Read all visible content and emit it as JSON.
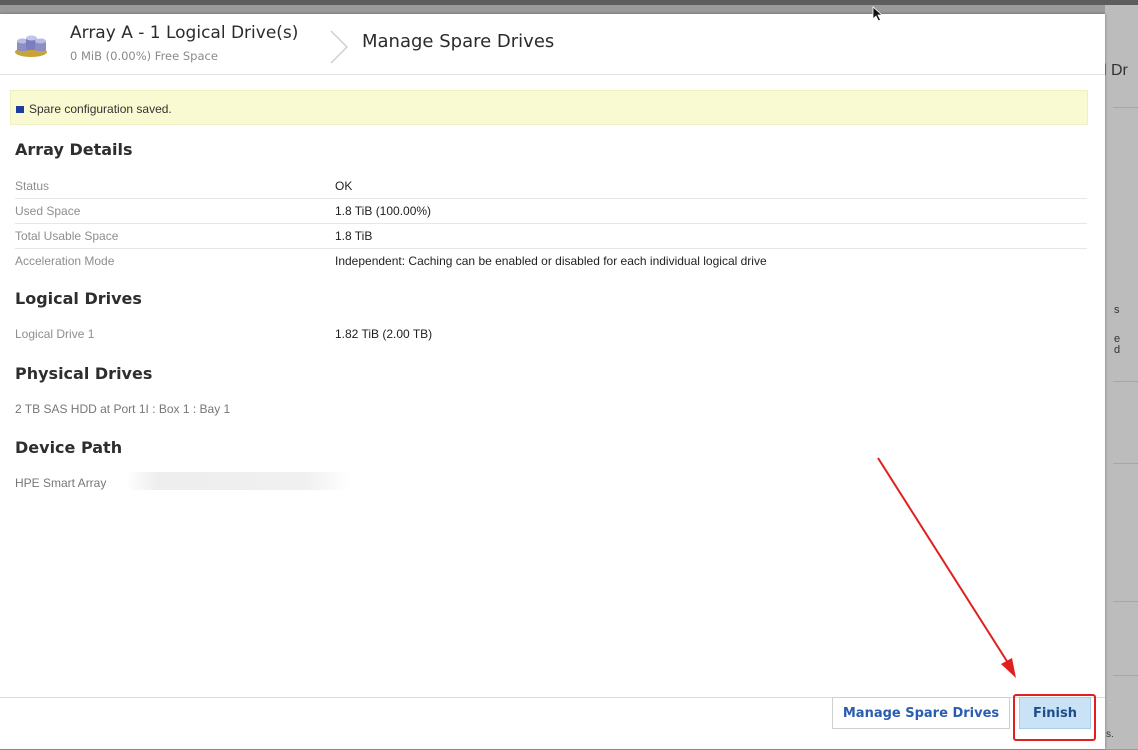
{
  "header": {
    "title": "Array A - 1 Logical Drive(s)",
    "subtitle": "0 MiB (0.00%) Free Space",
    "page_title": "Manage Spare Drives"
  },
  "notice": {
    "text": "Spare configuration saved.",
    "accent_color": "#1c3e9c"
  },
  "sections": {
    "array_details": {
      "title": "Array Details",
      "rows": [
        {
          "label": "Status",
          "value": "OK"
        },
        {
          "label": "Used Space",
          "value": "1.8 TiB (100.00%)"
        },
        {
          "label": "Total Usable Space",
          "value": "1.8 TiB"
        },
        {
          "label": "Acceleration Mode",
          "value": "Independent: Caching can be enabled or disabled for each individual logical drive"
        }
      ]
    },
    "logical_drives": {
      "title": "Logical Drives",
      "rows": [
        {
          "label": "Logical Drive 1",
          "value": "1.82 TiB (2.00 TB)"
        }
      ]
    },
    "physical_drives": {
      "title": "Physical Drives",
      "items": [
        "2 TB SAS HDD at Port 1I : Box 1 : Bay 1"
      ]
    },
    "device_path": {
      "title": "Device Path",
      "value": "HPE Smart Array"
    }
  },
  "footer": {
    "manage_spare_label": "Manage Spare Drives",
    "finish_label": "Finish"
  },
  "background": {
    "right_fragment": "l Dr",
    "fragment_e": "e",
    "fragment_d": "d",
    "fragment_s": "s",
    "fragment_period": "s."
  },
  "annotation_color": "#e02020"
}
